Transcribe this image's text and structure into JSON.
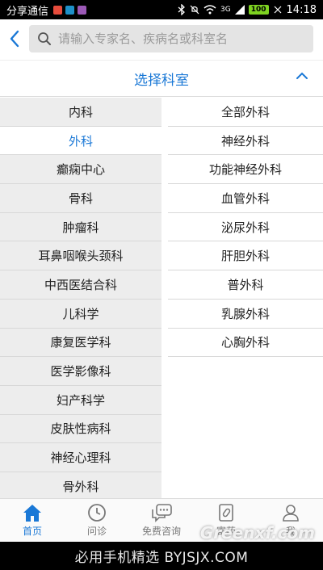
{
  "status_bar": {
    "carrier": "分享通信",
    "network": "3G",
    "battery": "100",
    "time": "14:18"
  },
  "search": {
    "placeholder": "请输入专家名、疾病名或科室名"
  },
  "section": {
    "title": "选择科室"
  },
  "left_departments": [
    "内科",
    "外科",
    "癫痫中心",
    "骨科",
    "肿瘤科",
    "耳鼻咽喉头颈科",
    "中西医结合科",
    "儿科学",
    "康复医学科",
    "医学影像科",
    "妇产科学",
    "皮肤性病科",
    "神经心理科",
    "骨外科"
  ],
  "left_selected": "外科",
  "right_departments": [
    "全部外科",
    "神经外科",
    "功能神经外科",
    "血管外科",
    "泌尿外科",
    "肝胆外科",
    "普外科",
    "乳腺外科",
    "心胸外科"
  ],
  "tabbar": {
    "items": [
      {
        "label": "首页",
        "icon": "home-icon",
        "active": true
      },
      {
        "label": "问诊",
        "icon": "clock-icon",
        "active": false
      },
      {
        "label": "免费咨询",
        "icon": "chat-icon",
        "active": false
      },
      {
        "label": "寄药",
        "icon": "medicine-icon",
        "active": false
      },
      {
        "label": "我",
        "icon": "user-icon",
        "active": false
      }
    ]
  },
  "watermark": "必用手机精选 BYJSJX.COM",
  "watermark_logo": "Greenxf.com",
  "colors": {
    "accent": "#1a78d6",
    "left_bg": "#ededed",
    "divider": "#d8d8d8"
  }
}
